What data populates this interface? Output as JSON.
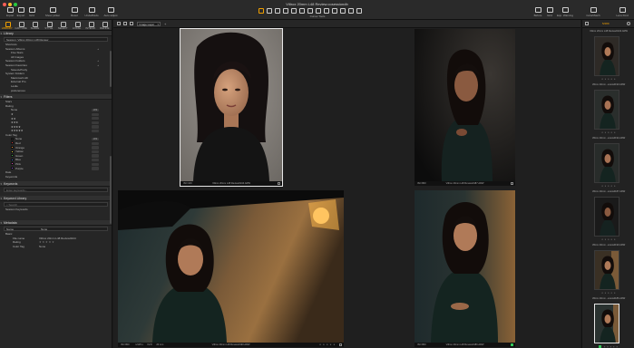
{
  "window": {
    "title": "Viltrox 20mm L48 Review.cosessiondb"
  },
  "toolbar": {
    "left": [
      {
        "label": "Import",
        "icon": "import-icon"
      },
      {
        "label": "Export",
        "icon": "export-icon"
      },
      {
        "label": "Grid",
        "icon": "grid-icon"
      },
      {
        "label": "Show picker",
        "icon": "picker-icon"
      },
      {
        "label": "Reset",
        "icon": "reset-icon"
      },
      {
        "label": "Undo/Redo",
        "icon": "undo-redo-icon"
      },
      {
        "label": "Auto adjust",
        "icon": "auto-adjust-icon"
      }
    ],
    "cursor_label": "Cursor Tools",
    "right": [
      {
        "label": "Before",
        "icon": "before-after-icon"
      },
      {
        "label": "Grid",
        "icon": "grid-icon"
      },
      {
        "label": "Exp. Warning",
        "icon": "exposure-warning-icon"
      },
      {
        "label": "ColorMatch",
        "icon": "colormatch-icon"
      },
      {
        "label": "Lens Kind",
        "icon": "lens-icon"
      }
    ]
  },
  "tool_tabs": [
    "LIBRARY",
    "CAPTURE",
    "SHARE",
    "STYLE",
    "SELECT",
    "LOCAL",
    "INTEGR.",
    "REFINE"
  ],
  "library": {
    "title": "Library",
    "session_select": "Session: Viltrox 20mm L48 Review",
    "rows": [
      {
        "label": "Shortcuts",
        "level": 0
      },
      {
        "label": "Session Albums",
        "level": 0,
        "plus": "+"
      },
      {
        "label": "Five Stars",
        "level": 1
      },
      {
        "label": "All Images",
        "level": 1
      },
      {
        "label": "Session Folders",
        "level": 0,
        "plus": "+"
      },
      {
        "label": "Session Favorites",
        "level": 0,
        "plus": "+"
      },
      {
        "label": "Saved+Pretty",
        "level": 1
      },
      {
        "label": "System Folders",
        "level": 0
      },
      {
        "label": "Macintosh HD",
        "level": 1
      },
      {
        "label": "External Pro",
        "level": 1
      },
      {
        "label": "Leslie",
        "level": 1
      },
      {
        "label": "preferences",
        "level": 1
      }
    ]
  },
  "filters": {
    "title": "Filters",
    "stars_head": "Stars",
    "rating_head": "Rating",
    "rating_rows": [
      {
        "label": "None",
        "count": "289"
      },
      {
        "label": "★",
        "count": ""
      },
      {
        "label": "★★",
        "count": ""
      },
      {
        "label": "★★★",
        "count": ""
      },
      {
        "label": "★★★★",
        "count": ""
      },
      {
        "label": "★★★★★",
        "count": ""
      }
    ],
    "color_head": "Color Tag",
    "color_rows": [
      {
        "label": "None",
        "count": "289",
        "color": "#2a2a2a"
      },
      {
        "label": "Red",
        "count": "",
        "color": "#d83a3a"
      },
      {
        "label": "Orange",
        "count": "",
        "color": "#e8892a"
      },
      {
        "label": "Yellow",
        "count": "",
        "color": "#e5d23a"
      },
      {
        "label": "Green",
        "count": "",
        "color": "#3fb44a"
      },
      {
        "label": "Blue",
        "count": "",
        "color": "#3a6fd8"
      },
      {
        "label": "Pink",
        "count": "",
        "color": "#d84ab0"
      },
      {
        "label": "Purple",
        "count": "",
        "color": "#8a4ad8"
      }
    ],
    "extra_rows": [
      "Date",
      "Keywords"
    ]
  },
  "keywords": {
    "title": "Keywords",
    "placeholder": "Enter keywords..."
  },
  "keyword_library": {
    "title": "Keyword Library",
    "search_placeholder": "Search",
    "row": "Session Keywords"
  },
  "metadata": {
    "title": "Metadata",
    "preset_label": "Name",
    "preset_value": "None",
    "group": "Basic",
    "fields": [
      {
        "label": "File name",
        "value": "Viltrox 20mm L48 Review0244"
      },
      {
        "label": "Rating",
        "value": "★ ★ ★ ★ ★"
      },
      {
        "label": "Color Tag",
        "value": "None"
      }
    ]
  },
  "viewer": {
    "zoom_label": "Image Layer",
    "images": [
      {
        "file": "Viltrox 20mm L48 Review0244.ARW",
        "iso": "ISO 100",
        "selected": true
      },
      {
        "file": "Viltrox 20mm L48 Review0187.ARW",
        "iso": "ISO 800",
        "selected": false
      },
      {
        "file": "Viltrox 20mm L48 Review0190.ARW",
        "iso": "ISO 800",
        "exposure": "1/125 s",
        "aperture": "f/2.8",
        "focal": "20 mm",
        "selected": false
      },
      {
        "file": "Viltrox 20mm L48 Review0186.ARW",
        "iso": "ISO 800",
        "selected": false
      }
    ]
  },
  "filmstrip": {
    "count_label": "5/289",
    "items": [
      {
        "name": "Viltrox 20mm L48 Review0244.ARW"
      },
      {
        "name": "Viltrox 20mm...eview0193.ARW"
      },
      {
        "name": "Viltrox 20mm...eview0194.ARW"
      },
      {
        "name": "Viltrox 20mm...eview0187.ARW"
      },
      {
        "name": "Viltrox 20mm...eview0190.ARW"
      },
      {
        "name": "Viltrox 20mm...eview0186.ARW"
      }
    ],
    "stars": "★ ★ ★ ★ ★"
  }
}
